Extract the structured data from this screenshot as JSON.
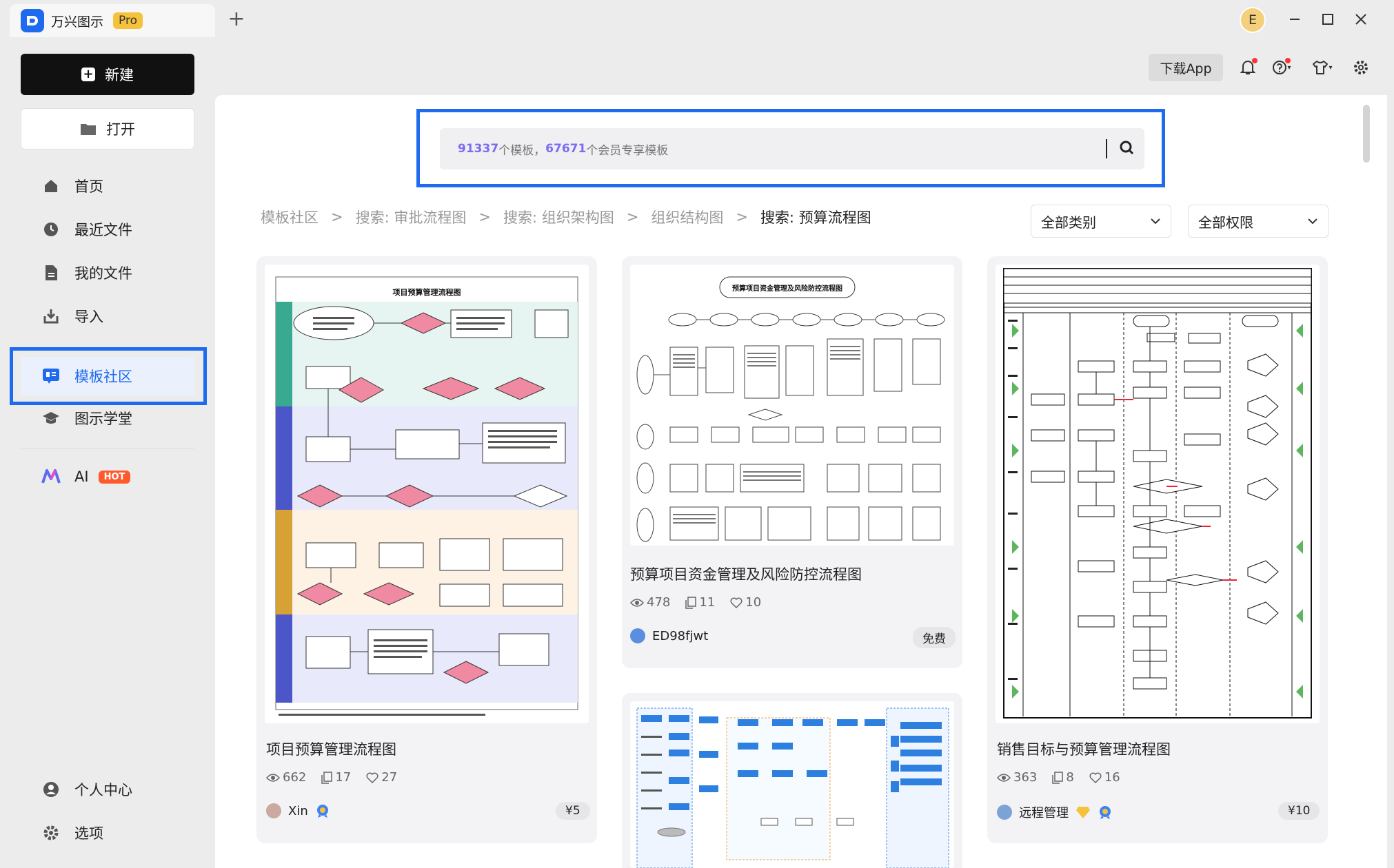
{
  "app": {
    "name": "万兴图示",
    "badge": "Pro",
    "new_tab": "+",
    "avatar_initial": "E"
  },
  "sidebar": {
    "new_label": "新建",
    "open_label": "打开",
    "items": [
      {
        "label": "首页",
        "icon": "home-icon"
      },
      {
        "label": "最近文件",
        "icon": "clock-icon"
      },
      {
        "label": "我的文件",
        "icon": "file-icon"
      },
      {
        "label": "导入",
        "icon": "import-icon"
      },
      {
        "label": "模板社区",
        "icon": "template-community-icon",
        "active": true
      },
      {
        "label": "图示学堂",
        "icon": "graduation-cap-icon"
      }
    ],
    "ai": {
      "label": "AI",
      "badge": "HOT"
    },
    "bottom": [
      {
        "label": "个人中心",
        "icon": "user-icon"
      },
      {
        "label": "选项",
        "icon": "gear-icon"
      }
    ]
  },
  "toolbar": {
    "download_label": "下载App"
  },
  "search": {
    "count_templates": "91337",
    "text_templates": "个模板，",
    "count_member": "67671",
    "text_member": "个会员专享模板"
  },
  "breadcrumb": [
    "模板社区",
    "搜索: 审批流程图",
    "搜索: 组织架构图",
    "组织结构图",
    "搜索: 预算流程图"
  ],
  "filters": {
    "category": "全部类别",
    "permission": "全部权限"
  },
  "cards": [
    {
      "title": "项目预算管理流程图",
      "thumb_title": "项目预算管理流程图",
      "views": "662",
      "copies": "17",
      "likes": "27",
      "author": "Xin",
      "price": "¥5"
    },
    {
      "title": "预算项目资金管理及风险防控流程图",
      "thumb_title": "预算项目资金管理及风险防控流程图",
      "views": "478",
      "copies": "11",
      "likes": "10",
      "author": "ED98fjwt",
      "price": "免费"
    },
    {
      "title": "销售目标与预算管理流程图",
      "views": "363",
      "copies": "8",
      "likes": "16",
      "author": "远程管理",
      "price": "¥10"
    }
  ],
  "colors": {
    "accent": "#1e6bf0",
    "pro_badge": "#f6c23c",
    "hot_badge": "#ff5a2b",
    "search_number": "#7b6cf0"
  }
}
